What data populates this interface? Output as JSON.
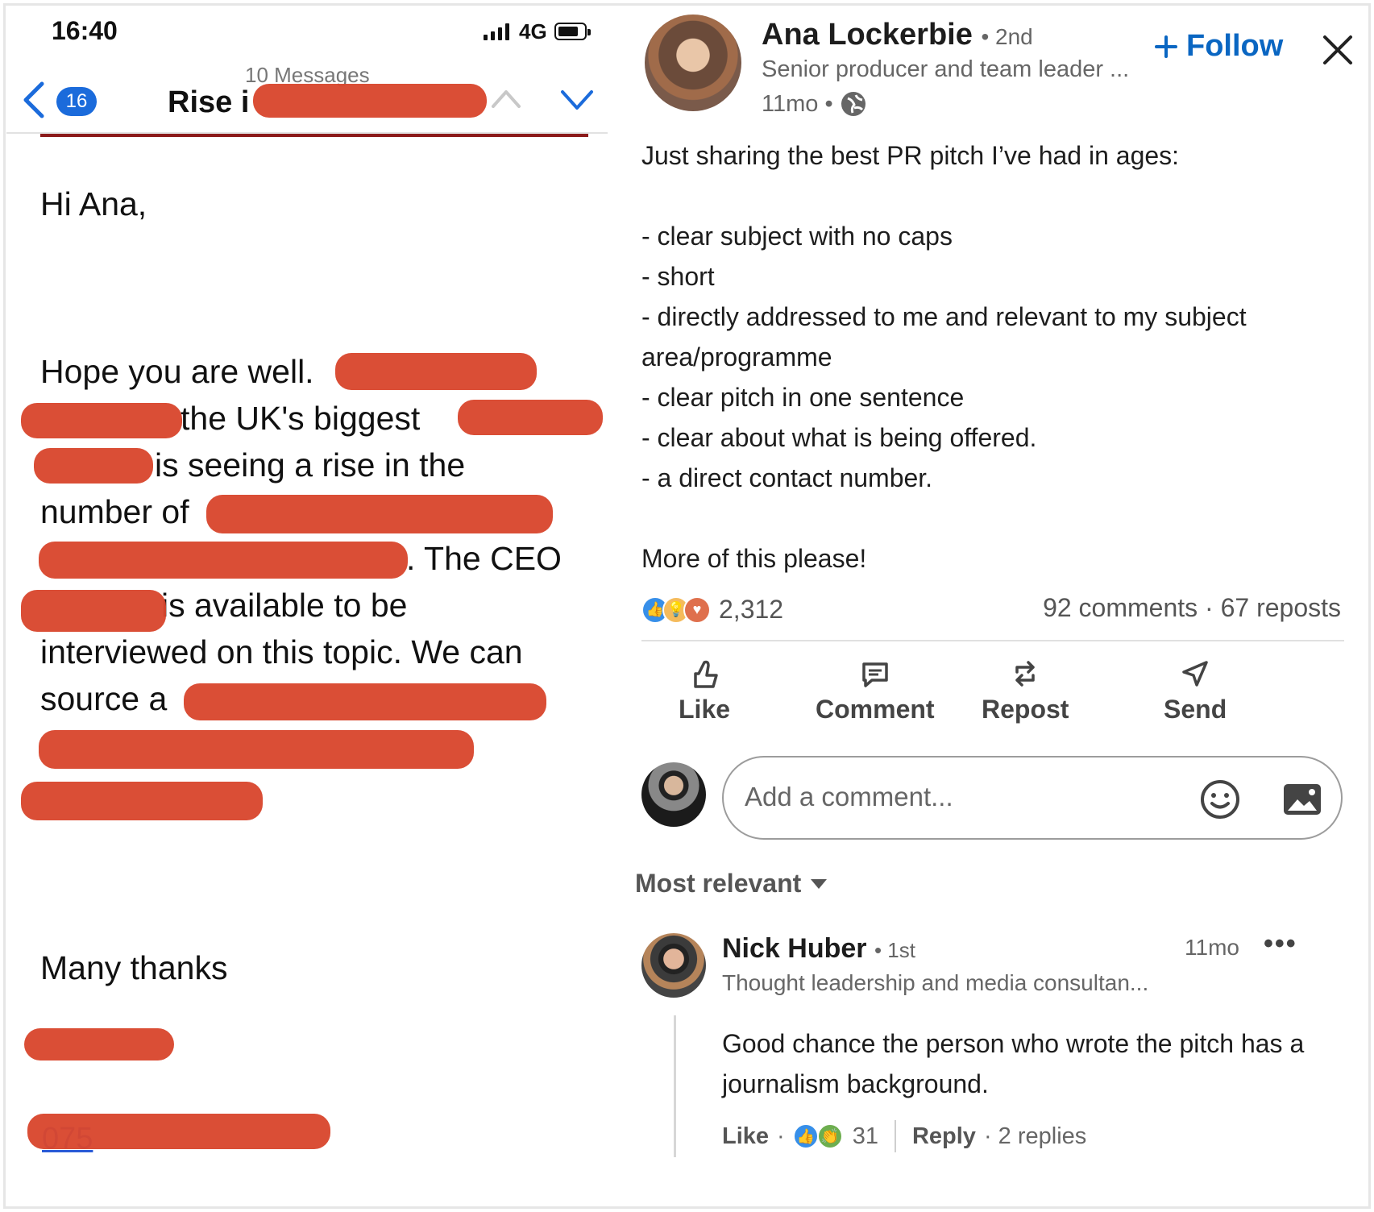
{
  "email": {
    "status_bar": {
      "time": "16:40",
      "network": "4G"
    },
    "header": {
      "unread_count": "16",
      "subject": "Rise i",
      "message_count": "10 Messages"
    },
    "body": {
      "greeting": "Hi Ana,",
      "line1": "Hope you are well.",
      "line2": "the UK's biggest",
      "line3": "is seeing a rise in the",
      "line4": "number of",
      "line5": ". The CEO",
      "line6": "is available to be",
      "line7": "interviewed on this topic. We can",
      "line8": "source a",
      "signoff": "Many thanks",
      "phone_fragment": "075"
    }
  },
  "post": {
    "author": {
      "name": "Ana Lockerbie",
      "degree": "• 2nd",
      "headline": "Senior producer and team leader ...",
      "time": "11mo •"
    },
    "follow_label": "Follow",
    "text": {
      "intro": "Just sharing the best PR pitch I’ve had in ages:",
      "bullets": [
        "- clear subject with no caps",
        "- short",
        "- directly addressed to me and relevant to my subject area/programme",
        "- clear pitch in one sentence",
        "- clear about what is being offered.",
        "- a direct contact number."
      ],
      "closing": "More of this please!"
    },
    "reaction_count": "2,312",
    "stats": "92 comments · 67 reposts",
    "actions": {
      "like": "Like",
      "comment": "Comment",
      "repost": "Repost",
      "send": "Send"
    },
    "comment_placeholder": "Add a comment...",
    "sort_label": "Most relevant",
    "comment": {
      "name": "Nick Huber",
      "degree": "• 1st",
      "headline": "Thought leadership and media consultan...",
      "time": "11mo",
      "text": "Good chance the person who wrote the pitch has a journalism background.",
      "like_label": "Like",
      "like_dot": "·",
      "reaction_count": "31",
      "reply_label": "Reply",
      "replies": "· 2 replies"
    },
    "colors": {
      "accent": "#0a66c2",
      "redaction": "#d9472e",
      "ios_blue": "#1b6bdb"
    }
  }
}
